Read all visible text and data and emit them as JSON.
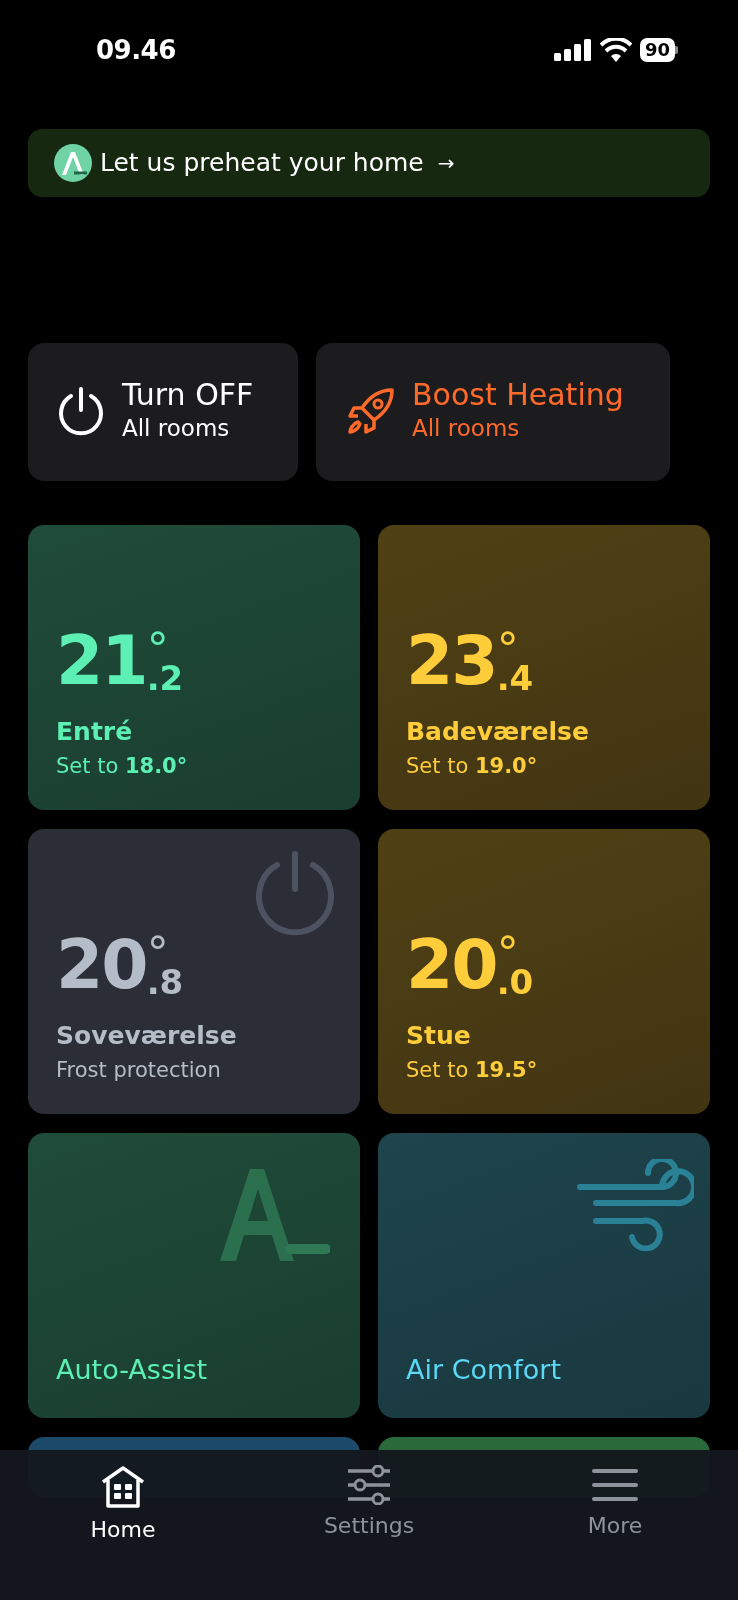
{
  "status_bar": {
    "time": "09.46",
    "battery": "90"
  },
  "banner": {
    "text": "Let us preheat your home",
    "arrow": "→"
  },
  "actions": [
    {
      "kind": "power",
      "title": "Turn OFF",
      "subtitle": "All rooms",
      "color": "#ffffff"
    },
    {
      "kind": "boost",
      "title": "Boost Heating",
      "subtitle": "All rooms",
      "color": "#ff6a2b"
    }
  ],
  "tiles": [
    {
      "kind": "room",
      "temp": "21",
      "decimal": ".2",
      "degree": "°",
      "name": "Entré",
      "status": "Set to **18.0°**",
      "color": "#5cf0b4",
      "off": false
    },
    {
      "kind": "room",
      "temp": "23",
      "decimal": ".4",
      "degree": "°",
      "name": "Badeværelse",
      "status": "Set to **19.0°**",
      "color": "#ffcc3a",
      "off": false
    },
    {
      "kind": "room",
      "temp": "20",
      "decimal": ".8",
      "degree": "°",
      "name": "Soveværelse",
      "status": "Frost protection",
      "color": "#b3bcc7",
      "off": true
    },
    {
      "kind": "room",
      "temp": "20",
      "decimal": ".0",
      "degree": "°",
      "name": "Stue",
      "status": "Set to **19.5°**",
      "color": "#ffcc3a",
      "off": false
    },
    {
      "kind": "assist",
      "name": "Auto-Assist",
      "color": "#5cf0b4"
    },
    {
      "kind": "air",
      "name": "Air Comfort",
      "color": "#5ad8f5"
    },
    {
      "kind": "covered",
      "color": "#1d4a6a"
    },
    {
      "kind": "covered",
      "color": "#2a6a3a"
    }
  ],
  "tabs": [
    {
      "label": "Home",
      "selected": true
    },
    {
      "label": "Settings",
      "selected": false
    },
    {
      "label": "More",
      "selected": false
    }
  ]
}
